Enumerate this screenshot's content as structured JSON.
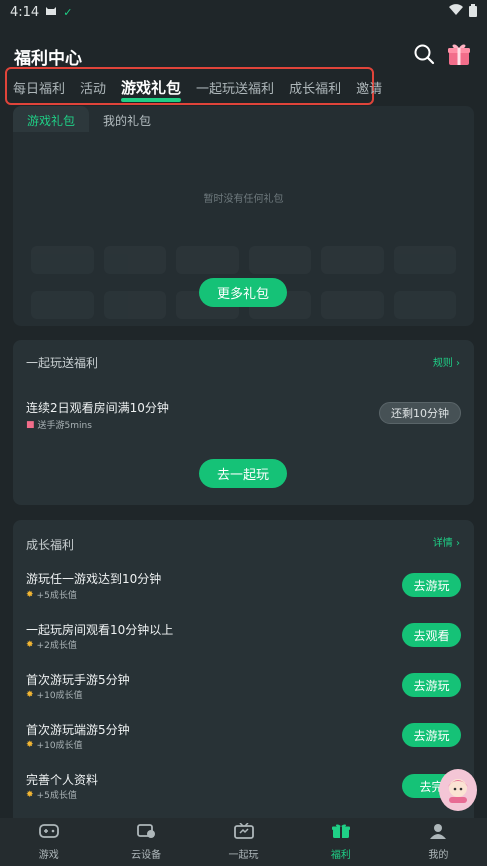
{
  "status_bar": {
    "time": "4:14"
  },
  "header": {
    "title": "福利中心"
  },
  "tabs": [
    {
      "label": "每日福利"
    },
    {
      "label": "活动"
    },
    {
      "label": "游戏礼包"
    },
    {
      "label": "一起玩送福利"
    },
    {
      "label": "成长福利"
    },
    {
      "label": "邀请"
    }
  ],
  "gift_section": {
    "subtabs": [
      {
        "label": "游戏礼包"
      },
      {
        "label": "我的礼包"
      }
    ],
    "empty_text": "暂时没有任何礼包",
    "more_button": "更多礼包"
  },
  "together_section": {
    "title": "一起玩送福利",
    "rules_link": "规则 ›",
    "task": {
      "title": "连续2日观看房间满10分钟",
      "reward": "送手游5mins",
      "status_button": "还剩10分钟"
    },
    "cta_button": "去一起玩"
  },
  "growth_section": {
    "title": "成长福利",
    "details_link": "详情 ›",
    "tasks": [
      {
        "title": "游玩任一游戏达到10分钟",
        "reward": "+5成长值",
        "button": "去游玩"
      },
      {
        "title": "一起玩房间观看10分钟以上",
        "reward": "+2成长值",
        "button": "去观看"
      },
      {
        "title": "首次游玩手游5分钟",
        "reward": "+10成长值",
        "button": "去游玩"
      },
      {
        "title": "首次游玩端游5分钟",
        "reward": "+10成长值",
        "button": "去游玩"
      },
      {
        "title": "完善个人资料",
        "reward": "+5成长值",
        "button": "去完"
      }
    ]
  },
  "bottom_nav": [
    {
      "label": "游戏",
      "icon": "gamepad-icon"
    },
    {
      "label": "云设备",
      "icon": "cloud-device-icon"
    },
    {
      "label": "一起玩",
      "icon": "tv-icon"
    },
    {
      "label": "福利",
      "icon": "gift-icon"
    },
    {
      "label": "我的",
      "icon": "person-icon"
    }
  ],
  "colors": {
    "accent": "#15c277",
    "highlight_border": "#e0443a",
    "background": "#1f2629"
  }
}
